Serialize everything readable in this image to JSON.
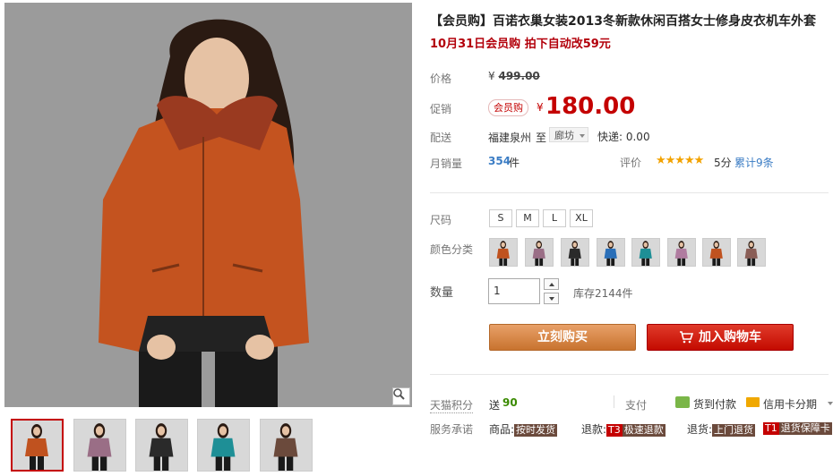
{
  "product": {
    "title": "【会员购】百诺衣巢女装2013冬新款休闲百搭女士修身皮衣机车外套",
    "promo": "10月31日会员购 拍下自动改59元"
  },
  "price": {
    "label": "价格",
    "currency": "¥",
    "original": "499.00"
  },
  "promotion": {
    "label": "促销",
    "member_tag": "会员购",
    "currency": "¥",
    "price": "180.00"
  },
  "delivery": {
    "label": "配送",
    "from": "福建泉州",
    "to_word": "至",
    "destination": "廊坊",
    "express": "快递: 0.00"
  },
  "sales": {
    "label": "月销量",
    "count": "354",
    "unit": "件"
  },
  "rating": {
    "label": "评价",
    "stars": "★★★★★",
    "score": "5分",
    "cumulative": "累计9条"
  },
  "size": {
    "label": "尺码",
    "options": [
      "S",
      "M",
      "L",
      "XL"
    ]
  },
  "color": {
    "label": "颜色分类",
    "swatches": [
      "#c0521f",
      "#9a6e86",
      "#2a2a2a",
      "#2a6fb8",
      "#1e8f96",
      "#b07ca0",
      "#c0521f",
      "#8a5e57"
    ]
  },
  "quantity": {
    "label": "数量",
    "value": "1",
    "stock": "库存2144件"
  },
  "buttons": {
    "buy_now": "立刻购买",
    "add_cart": "加入购物车"
  },
  "points": {
    "label": "天猫积分",
    "prefix": "送",
    "value": "90"
  },
  "payment": {
    "label": "支付",
    "cod": "货到付款",
    "installment": "信用卡分期"
  },
  "service": {
    "label": "服务承诺",
    "goods_label": "商品:",
    "goods_tag": "按时发货",
    "refund_label": "退款:",
    "refund_badge": "T3",
    "refund_tag": "极速退款",
    "return_label": "退货:",
    "return_tag": "上门退货",
    "card_badge": "T1",
    "card_tag": "退货保障卡"
  },
  "gallery": {
    "thumb_colors": [
      "#c0521f",
      "#9a6e86",
      "#2a2a2a",
      "#1e8f96",
      "#6b4a3c"
    ]
  }
}
